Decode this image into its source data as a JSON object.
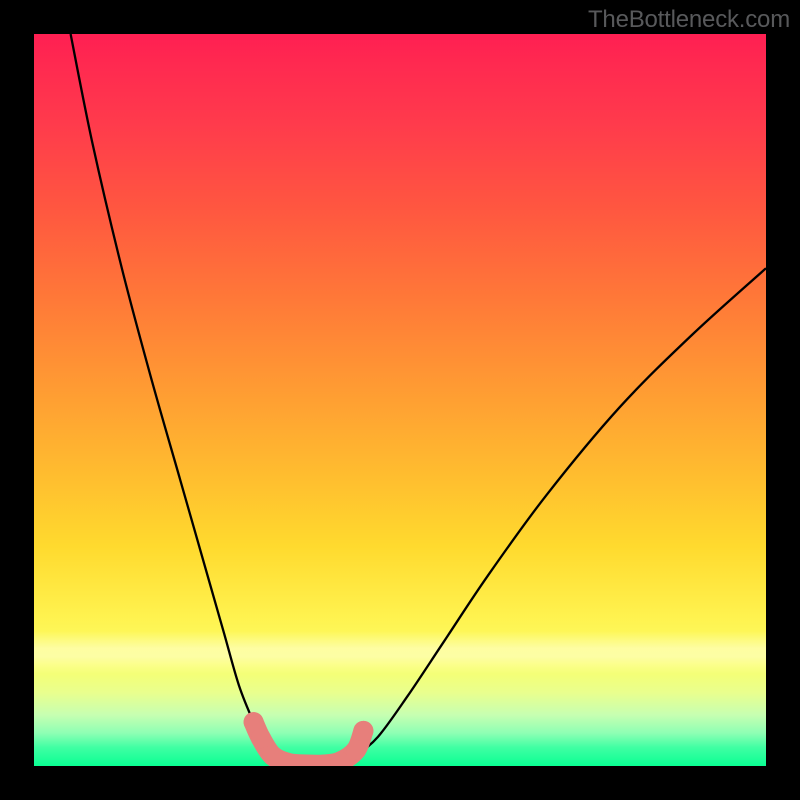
{
  "watermark": "TheBottleneck.com",
  "chart_data": {
    "type": "line",
    "title": "",
    "xlabel": "",
    "ylabel": "",
    "xlim": [
      0,
      1
    ],
    "ylim": [
      0,
      1
    ],
    "background_gradient_stops": [
      {
        "pos": 0.0,
        "color": "#ff1f52"
      },
      {
        "pos": 0.5,
        "color": "#ff9a33"
      },
      {
        "pos": 0.8,
        "color": "#fff350"
      },
      {
        "pos": 1.0,
        "color": "#0aff93"
      }
    ],
    "series": [
      {
        "name": "bottleneck-curve",
        "color": "#000000",
        "x": [
          0.05,
          0.08,
          0.12,
          0.16,
          0.2,
          0.24,
          0.26,
          0.28,
          0.3,
          0.32,
          0.34,
          0.36,
          0.38,
          0.4,
          0.42,
          0.44,
          0.47,
          0.51,
          0.56,
          0.62,
          0.7,
          0.8,
          0.9,
          1.0
        ],
        "y": [
          1.0,
          0.85,
          0.68,
          0.53,
          0.39,
          0.25,
          0.18,
          0.11,
          0.06,
          0.02,
          0.005,
          0.0,
          0.0,
          0.0,
          0.005,
          0.015,
          0.04,
          0.095,
          0.17,
          0.26,
          0.37,
          0.49,
          0.59,
          0.68
        ]
      }
    ],
    "markers": {
      "name": "highlighted-points",
      "color": "#e77f7b",
      "radius_px": 10,
      "points_xy": [
        [
          0.3,
          0.06
        ],
        [
          0.31,
          0.038
        ],
        [
          0.326,
          0.014
        ],
        [
          0.348,
          0.004
        ],
        [
          0.372,
          0.002
        ],
        [
          0.396,
          0.002
        ],
        [
          0.418,
          0.006
        ],
        [
          0.44,
          0.022
        ],
        [
          0.45,
          0.048
        ]
      ]
    }
  }
}
